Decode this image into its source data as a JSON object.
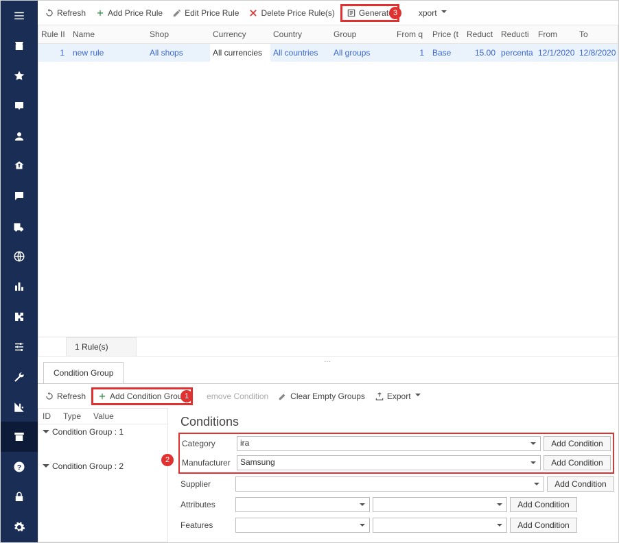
{
  "toolbar": {
    "refresh": "Refresh",
    "add": "Add Price Rule",
    "edit": "Edit Price Rule",
    "delete": "Delete Price Rule(s)",
    "generate": "Generate",
    "export": "xport"
  },
  "badges": {
    "b1": "1",
    "b2": "2",
    "b3": "3"
  },
  "cols": {
    "ruleId": "Rule II",
    "name": "Name",
    "shop": "Shop",
    "currency": "Currency",
    "country": "Country",
    "group": "Group",
    "fromq": "From q",
    "price": "Price (t",
    "reduct": "Reduct",
    "reducti": "Reducti",
    "from": "From",
    "to": "To"
  },
  "row": {
    "ruleId": "1",
    "name": "new rule",
    "shop": "All shops",
    "currency": "All currencies",
    "country": "All countries",
    "group": "All groups",
    "fromq": "1",
    "price": "Base",
    "reduct": "15.00",
    "reducti": "percenta",
    "from": "12/1/2020",
    "to": "12/8/2020"
  },
  "rulesCount": "1 Rule(s)",
  "tab": "Condition Group",
  "lower": {
    "refresh": "Refresh",
    "addGroup": "Add Condition Group",
    "remove": "emove Condition",
    "clear": "Clear Empty Groups",
    "export": "Export"
  },
  "tree": {
    "hId": "ID",
    "hType": "Type",
    "hValue": "Value",
    "g1": "Condition Group : 1",
    "g2": "Condition Group : 2"
  },
  "cond": {
    "title": "Conditions",
    "category": "Category",
    "categoryVal": "ira",
    "manufacturer": "Manufacturer",
    "manufacturerVal": "Samsung",
    "supplier": "Supplier",
    "attributes": "Attributes",
    "features": "Features",
    "addBtn": "Add Condition"
  }
}
